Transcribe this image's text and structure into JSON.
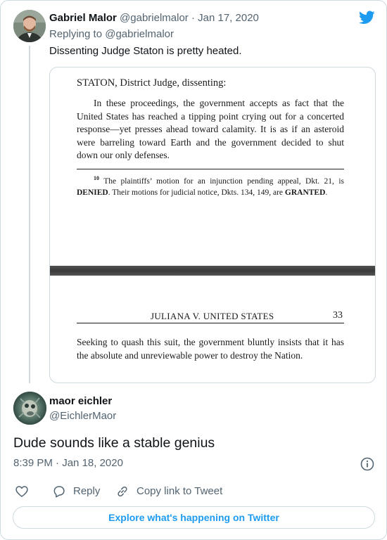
{
  "tweet": {
    "author_name": "Gabriel Malor",
    "author_handle": "@gabrielmalor",
    "separator": "·",
    "date": "Jan 17, 2020",
    "replying_prefix": "Replying to",
    "replying_to": "@gabrielmalor",
    "text": "Dissenting Judge Staton is pretty heated."
  },
  "image_text": {
    "heading": "STATON, District Judge, dissenting:",
    "paragraph": "In these proceedings, the government accepts as fact that the United States has reached a tipping point crying out for a concerted response—yet presses ahead toward calamity. It is as if an asteroid were barreling toward Earth and the government decided to shut down our only defenses.",
    "footnote_number": "10",
    "footnote_part1": "The plaintiffs’ motion for an injunction pending appeal, Dkt. 21, is",
    "footnote_denied": "DENIED",
    "footnote_part2": ". Their motions for judicial notice, Dkts. 134, 149, are",
    "footnote_granted": "GRANTED",
    "footnote_end": ".",
    "page_header": "JULIANA V. UNITED STATES",
    "page_number": "33",
    "paragraph2": "Seeking to quash this suit, the government bluntly insists that it has the absolute and unreviewable power to destroy the Nation."
  },
  "reply": {
    "author_name": "maor eichler",
    "author_handle": "@EichlerMaor",
    "text": "Dude sounds like a stable genius",
    "time": "8:39 PM",
    "separator": "·",
    "date": "Jan 18, 2020"
  },
  "actions": {
    "like_icon": "heart-icon",
    "reply_label": "Reply",
    "reply_icon": "speech-bubble-icon",
    "copy_label": "Copy link to Tweet",
    "copy_icon": "link-icon"
  },
  "explore_button": "Explore what's happening on Twitter",
  "colors": {
    "accent": "#1d9bf0",
    "muted": "#536471",
    "text": "#0f1419",
    "border": "#cfd9de"
  }
}
